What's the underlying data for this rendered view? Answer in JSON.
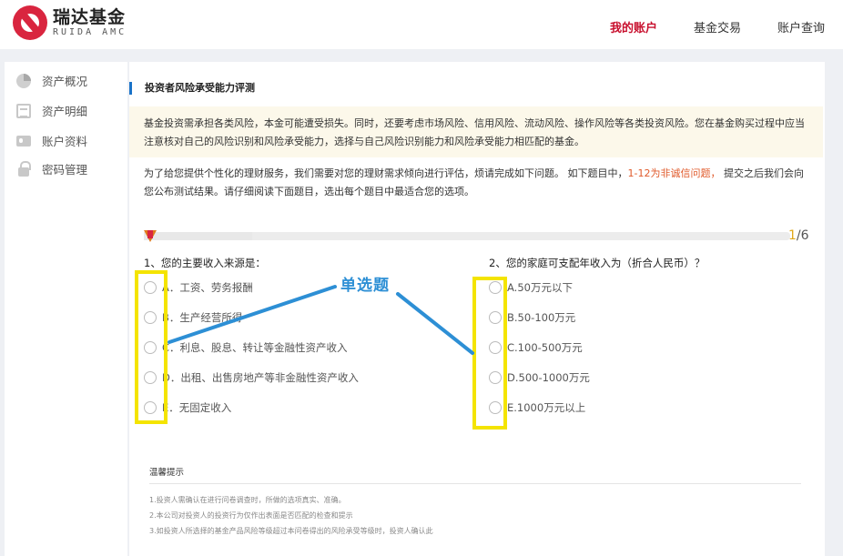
{
  "brand": {
    "name_cn": "瑞达基金",
    "name_en": "RUIDA AMC",
    "color": "#d9253f"
  },
  "topnav": {
    "items": [
      {
        "label": "我的账户",
        "active": true
      },
      {
        "label": "基金交易",
        "active": false
      },
      {
        "label": "账户查询",
        "active": false
      }
    ]
  },
  "sidebar": {
    "items": [
      {
        "label": "资产概况",
        "icon": "pie-chart-icon"
      },
      {
        "label": "资产明细",
        "icon": "list-icon"
      },
      {
        "label": "账户资料",
        "icon": "id-card-icon"
      },
      {
        "label": "密码管理",
        "icon": "lock-icon"
      }
    ]
  },
  "page": {
    "title": "投资者风险承受能力评测",
    "notice": "基金投资需承担各类风险，本金可能遭受损失。同时，还要考虑市场风险、信用风险、流动风险、操作风险等各类投资风险。您在基金购买过程中应当注意核对自己的风险识别和风险承受能力，选择与自己风险识别能力和风险承受能力相匹配的基金。",
    "intro_pre": "为了给您提供个性化的理财服务，我们需要对您的理财需求倾向进行评估，烦请完成如下问题。 如下题目中，",
    "intro_highlight": "1-12为非诚信问题，",
    "intro_post": " 提交之后我们会向您公布测试结果。请仔细阅读下面题目，选出每个题目中最适合您的选项。"
  },
  "progress": {
    "current": "1",
    "total": "/6",
    "fraction": 0.167
  },
  "questions": [
    {
      "title": "1、您的主要收入来源是：",
      "options": [
        "A．工资、劳务报酬",
        "B．生产经营所得",
        "C．利息、股息、转让等金融性资产收入",
        "D．出租、出售房地产等非金融性资产收入",
        "E．无固定收入"
      ]
    },
    {
      "title": "2、您的家庭可支配年收入为（折合人民币）？",
      "options": [
        "A.50万元以下",
        "B.50-100万元",
        "C.100-500万元",
        "D.500-1000万元",
        "E.1000万元以上"
      ]
    }
  ],
  "annotation": {
    "label": "单选题",
    "color": "#2d8fd5",
    "highlight_color": "#f4e400"
  },
  "tips": {
    "title": "温馨提示",
    "lines": [
      "1.投资人需确认在进行问卷调查时，所做的选项真实、准确。",
      "2.本公司对投资人的投资行为仅作出表面是否匹配的检查和提示",
      "3.如投资人所选择的基金产品风险等级超过本问卷得出的风险承受等级时，投资人确认此"
    ]
  }
}
